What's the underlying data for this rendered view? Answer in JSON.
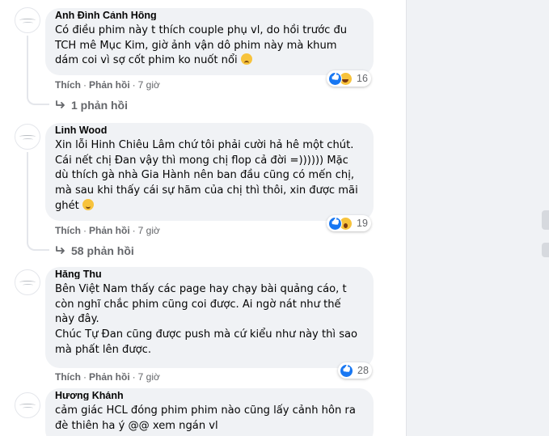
{
  "comments": [
    {
      "author": "Anh Đình Cảnh Hồng",
      "lines": [
        "Có điều phim này t thích couple phụ vl, do hồi trước đu",
        "TCH mê Mục Kim, giờ ảnh vận dô phim này mà khum",
        "dám coi vì sợ cốt phim ko nuốt nổi"
      ],
      "end_emoji": "sad-face-emoji",
      "like_label": "Thích",
      "reply_label": "Phản hồi",
      "time": "7 giờ",
      "reaction_icons": [
        "like",
        "haha"
      ],
      "reaction_count": "16",
      "replies_label": "1 phản hồi"
    },
    {
      "author": "Linh Wood",
      "lines": [
        "Xin lỗi Hinh Chiêu Lâm chứ tôi phải cười hả hê một chút.",
        "Cái nết chị Đan vậy thì mong chị flop cả đời =)))))) Mặc",
        "dù thích gà nhà Gia Hành nên ban đầu cũng có mến chị,",
        "mà sau khi thấy cái sự hãm của chị thì thôi, xin được mãi",
        "ghét"
      ],
      "end_emoji": "grin-face-emoji",
      "like_label": "Thích",
      "reply_label": "Phản hồi",
      "time": "7 giờ",
      "reaction_icons": [
        "like",
        "wow"
      ],
      "reaction_count": "19",
      "replies_label": "58 phản hồi"
    },
    {
      "author": "Hằng Thu",
      "lines": [
        "Bên Việt Nam thấy các page hay chạy bài quảng cáo, t",
        "còn nghĩ chắc phim cũng coi được. Ai ngờ nát như thế",
        "này đây.",
        "Chúc Tự Đan cũng được push mà cứ kiểu như này thì sao",
        "mà phất lên được."
      ],
      "end_emoji": "",
      "like_label": "Thích",
      "reply_label": "Phản hồi",
      "time": "7 giờ",
      "reaction_icons": [
        "like"
      ],
      "reaction_count": "28",
      "replies_label": ""
    },
    {
      "author": "Hương Khánh",
      "lines": [
        "cảm giác HCL đóng phim phim nào cũng lấy cảnh hôn ra",
        "đè thiên ha ý @@ xem ngán vl"
      ],
      "end_emoji": "",
      "like_label": "",
      "reply_label": "",
      "time": "",
      "reaction_icons": [],
      "reaction_count": "",
      "replies_label": ""
    }
  ],
  "dot_separator": "·",
  "colors": {
    "bubble": "#f0f2f5",
    "meta_text": "#65676b",
    "like_blue": "#1877f2",
    "emoji_yellow": "#f7c33c",
    "side_panel": "#f0f2f5"
  }
}
